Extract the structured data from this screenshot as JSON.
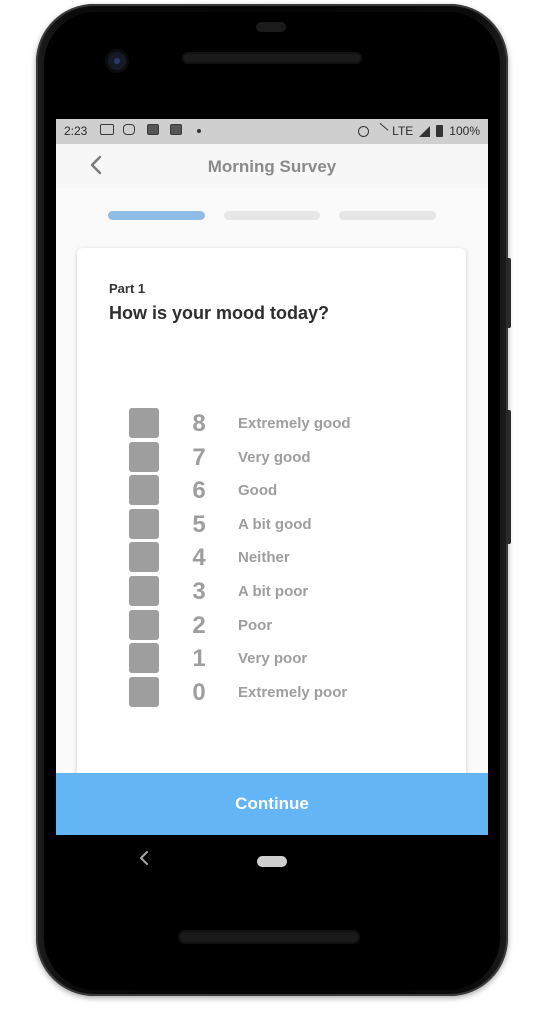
{
  "status_bar": {
    "time": "2:23",
    "network": "LTE",
    "battery": "100%",
    "icons": [
      "keyboard-icon",
      "instagram-icon",
      "app-icon",
      "app-icon",
      "dot-icon",
      "alarm-icon",
      "mute-icon",
      "signal-icon",
      "battery-icon"
    ]
  },
  "app_bar": {
    "title": "Morning Survey"
  },
  "progress": {
    "steps": 3,
    "current": 1,
    "active_color": "#90bde6",
    "inactive_color": "#e6e6e6"
  },
  "card": {
    "part_label": "Part 1",
    "question": "How is your mood today?",
    "options": [
      {
        "value": "8",
        "label": "Extremely good"
      },
      {
        "value": "7",
        "label": "Very good"
      },
      {
        "value": "6",
        "label": "Good"
      },
      {
        "value": "5",
        "label": "A bit good"
      },
      {
        "value": "4",
        "label": "Neither"
      },
      {
        "value": "3",
        "label": "A bit poor"
      },
      {
        "value": "2",
        "label": "Poor"
      },
      {
        "value": "1",
        "label": "Very poor"
      },
      {
        "value": "0",
        "label": "Extremely poor"
      }
    ]
  },
  "footer": {
    "continue_label": "Continue",
    "accent": "#64b5f6"
  }
}
